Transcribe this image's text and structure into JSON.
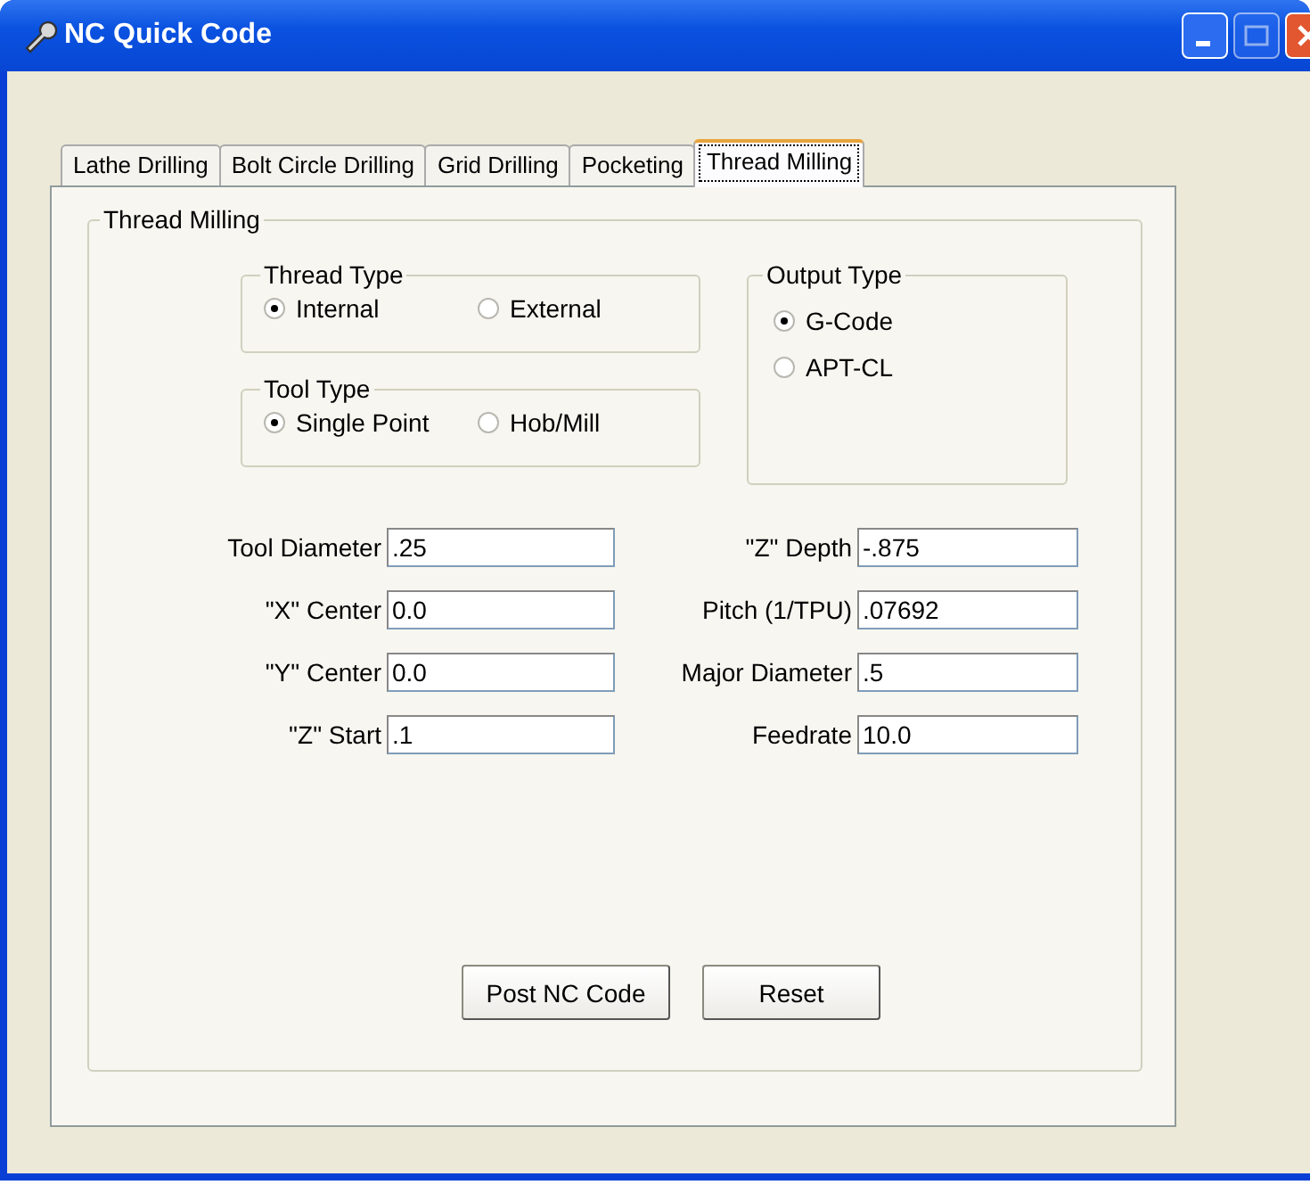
{
  "window": {
    "title": "NC Quick Code"
  },
  "tabs": [
    {
      "label": "Lathe Drilling",
      "selected": false
    },
    {
      "label": "Bolt Circle Drilling",
      "selected": false
    },
    {
      "label": "Grid Drilling",
      "selected": false
    },
    {
      "label": "Pocketing",
      "selected": false
    },
    {
      "label": "Thread Milling",
      "selected": true
    }
  ],
  "panel": {
    "title": "Thread Milling",
    "thread_type": {
      "title": "Thread Type",
      "options": [
        {
          "label": "Internal",
          "selected": true
        },
        {
          "label": "External",
          "selected": false
        }
      ]
    },
    "tool_type": {
      "title": "Tool Type",
      "options": [
        {
          "label": "Single Point",
          "selected": true
        },
        {
          "label": "Hob/Mill",
          "selected": false
        }
      ]
    },
    "output_type": {
      "title": "Output Type",
      "options": [
        {
          "label": "G-Code",
          "selected": true
        },
        {
          "label": "APT-CL",
          "selected": false
        }
      ]
    },
    "fields_left": [
      {
        "label": "Tool Diameter",
        "value": ".25"
      },
      {
        "label": "\"X\" Center",
        "value": "0.0"
      },
      {
        "label": "\"Y\" Center",
        "value": "0.0"
      },
      {
        "label": "\"Z\" Start",
        "value": ".1"
      }
    ],
    "fields_right": [
      {
        "label": "\"Z\" Depth",
        "value": "-.875"
      },
      {
        "label": "Pitch (1/TPU)",
        "value": ".07692"
      },
      {
        "label": "Major Diameter",
        "value": ".5"
      },
      {
        "label": "Feedrate",
        "value": "10.0"
      }
    ],
    "buttons": [
      "Post NC Code",
      "Reset"
    ]
  }
}
